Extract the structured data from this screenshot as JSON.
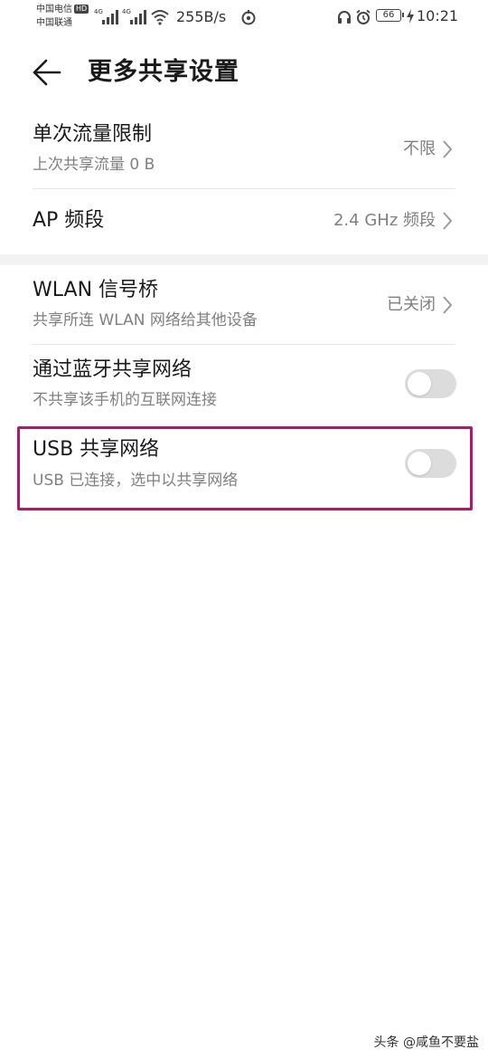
{
  "status_bar": {
    "carrier_1": "中国电信",
    "carrier_1_badge": "HD",
    "carrier_2": "中国联通",
    "network_1": "4G",
    "network_2": "4G",
    "speed": "255B/s",
    "battery": "66",
    "time": "10:21"
  },
  "header": {
    "title": "更多共享设置"
  },
  "settings": {
    "single_limit": {
      "title": "单次流量限制",
      "subtitle": "上次共享流量 0 B",
      "value": "不限"
    },
    "ap_band": {
      "title": "AP 频段",
      "value": "2.4 GHz 频段"
    },
    "wlan_bridge": {
      "title": "WLAN 信号桥",
      "subtitle": "共享所连 WLAN 网络给其他设备",
      "value": "已关闭"
    },
    "bluetooth_share": {
      "title": "通过蓝牙共享网络",
      "subtitle": "不共享该手机的互联网连接",
      "enabled": false
    },
    "usb_share": {
      "title": "USB 共享网络",
      "subtitle": "USB 已连接，选中以共享网络",
      "enabled": false
    }
  },
  "colors": {
    "highlight_border": "#b3166e",
    "toggle_off": "#dcdcdc",
    "secondary_text": "#808080"
  },
  "watermark": "头条 @咸鱼不要盐"
}
